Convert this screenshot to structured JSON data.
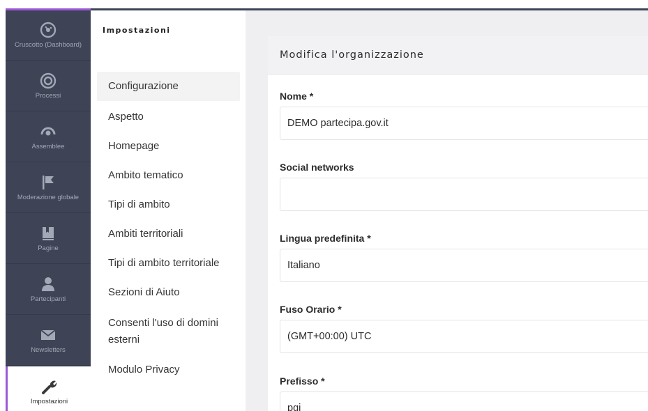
{
  "sidebar": {
    "items": [
      {
        "label": "Cruscotto (Dashboard)",
        "icon": "dashboard-icon"
      },
      {
        "label": "Processi",
        "icon": "target-icon"
      },
      {
        "label": "Assemblee",
        "icon": "assembly-icon"
      },
      {
        "label": "Moderazione globale",
        "icon": "flag-icon"
      },
      {
        "label": "Pagine",
        "icon": "book-icon"
      },
      {
        "label": "Partecipanti",
        "icon": "person-icon"
      },
      {
        "label": "Newsletters",
        "icon": "envelope-icon"
      },
      {
        "label": "Impostazioni",
        "icon": "wrench-icon",
        "active": true
      }
    ]
  },
  "subnav": {
    "title": "Impostazioni",
    "items": [
      {
        "label": "Configurazione",
        "active": true
      },
      {
        "label": "Aspetto"
      },
      {
        "label": "Homepage"
      },
      {
        "label": "Ambito tematico"
      },
      {
        "label": "Tipi di ambito"
      },
      {
        "label": "Ambiti territoriali"
      },
      {
        "label": "Tipi di ambito territoriale"
      },
      {
        "label": "Sezioni di Aiuto"
      },
      {
        "label": "Consenti l'uso di domini esterni"
      },
      {
        "label": "Modulo Privacy"
      }
    ]
  },
  "form": {
    "title": "Modifica l'organizzazione",
    "fields": [
      {
        "label": "Nome *",
        "value": "DEMO partecipa.gov.it"
      },
      {
        "label": "Social networks",
        "value": ""
      },
      {
        "label": "Lingua predefinita *",
        "value": "Italiano"
      },
      {
        "label": "Fuso Orario *",
        "value": "(GMT+00:00) UTC"
      },
      {
        "label": "Prefisso *",
        "value": "pgi"
      }
    ]
  },
  "colors": {
    "sidebar_bg": "#3e4356",
    "accent": "#9b59d6",
    "content_bg": "#efeff2"
  }
}
